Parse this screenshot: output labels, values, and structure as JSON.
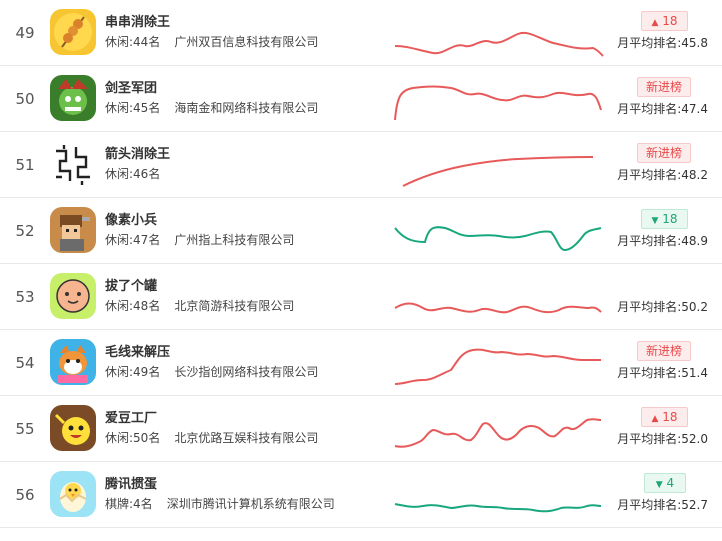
{
  "avg_label_prefix": "月平均排名:",
  "colors": {
    "up": "#e85a5a",
    "down": "#19a87e",
    "new": "#e84a4a"
  },
  "rows": [
    {
      "rank": "49",
      "name": "串串消除王",
      "category": "休闲:44名",
      "developer": "广州双百信息科技有限公司",
      "badge": {
        "type": "up",
        "arrow": "▲",
        "value": "18"
      },
      "avg": "月平均排名:45.8",
      "trend": "red",
      "icon": "skewer-icon"
    },
    {
      "rank": "50",
      "name": "剑圣军团",
      "category": "休闲:45名",
      "developer": "海南金和网络科技有限公司",
      "badge": {
        "type": "new",
        "arrow": "",
        "value": "新进榜"
      },
      "avg": "月平均排名:47.4",
      "trend": "red",
      "icon": "warrior-icon"
    },
    {
      "rank": "51",
      "name": "箭头消除王",
      "category": "休闲:46名",
      "developer": "",
      "badge": {
        "type": "new",
        "arrow": "",
        "value": "新进榜"
      },
      "avg": "月平均排名:48.2",
      "trend": "red",
      "icon": "arrow-maze-icon"
    },
    {
      "rank": "52",
      "name": "像素小兵",
      "category": "休闲:47名",
      "developer": "广州指上科技有限公司",
      "badge": {
        "type": "down",
        "arrow": "▼",
        "value": "18"
      },
      "avg": "月平均排名:48.9",
      "trend": "green",
      "icon": "pixel-soldier-icon"
    },
    {
      "rank": "53",
      "name": "拔了个罐",
      "category": "休闲:48名",
      "developer": "北京简游科技有限公司",
      "badge": null,
      "avg": "月平均排名:50.2",
      "trend": "red",
      "icon": "smiley-face-icon"
    },
    {
      "rank": "54",
      "name": "毛线来解压",
      "category": "休闲:49名",
      "developer": "长沙指创网络科技有限公司",
      "badge": {
        "type": "new",
        "arrow": "",
        "value": "新进榜"
      },
      "avg": "月平均排名:51.4",
      "trend": "red",
      "icon": "shiba-dog-icon"
    },
    {
      "rank": "55",
      "name": "爱豆工厂",
      "category": "休闲:50名",
      "developer": "北京优路互娱科技有限公司",
      "badge": {
        "type": "up",
        "arrow": "▲",
        "value": "18"
      },
      "avg": "月平均排名:52.0",
      "trend": "red",
      "icon": "bean-character-icon"
    },
    {
      "rank": "56",
      "name": "腾讯掼蛋",
      "category": "棋牌:4名",
      "developer": "深圳市腾讯计算机系统有限公司",
      "badge": {
        "type": "down",
        "arrow": "▼",
        "value": "4"
      },
      "avg": "月平均排名:52.7",
      "trend": "green",
      "icon": "chick-egg-icon"
    }
  ]
}
